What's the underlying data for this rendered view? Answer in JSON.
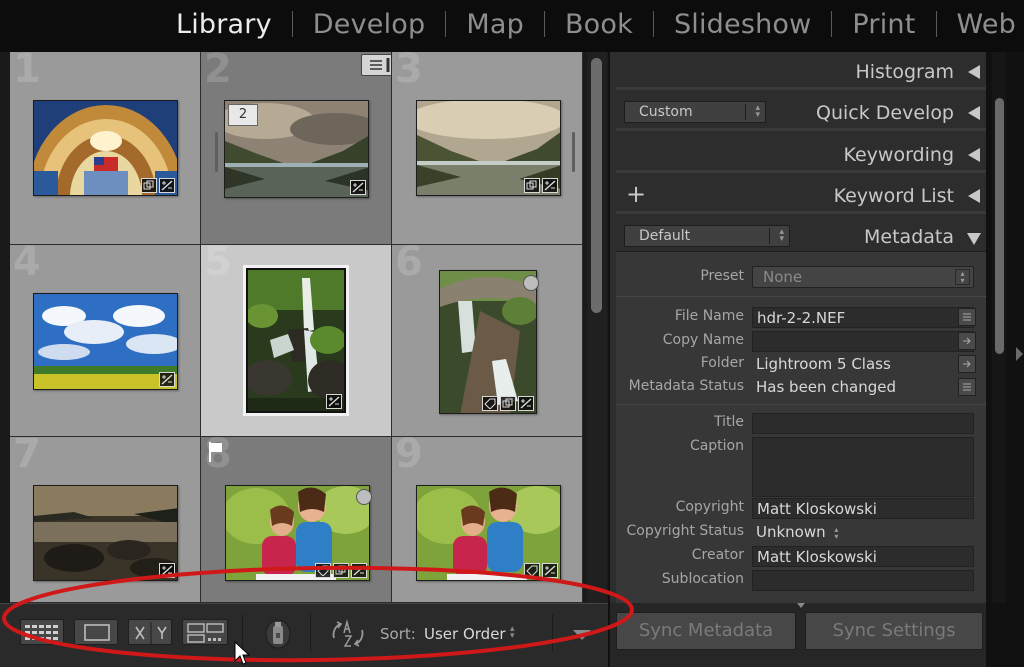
{
  "modules": [
    {
      "label": "Library",
      "active": true
    },
    {
      "label": "Develop",
      "active": false
    },
    {
      "label": "Map",
      "active": false
    },
    {
      "label": "Book",
      "active": false
    },
    {
      "label": "Slideshow",
      "active": false
    },
    {
      "label": "Print",
      "active": false
    },
    {
      "label": "Web",
      "active": false
    }
  ],
  "grid": {
    "cells": [
      {
        "num": "1",
        "photo": "rotunda-interior"
      },
      {
        "num": "2",
        "photo": "fjord-hdr",
        "stack_count": "2"
      },
      {
        "num": "3",
        "photo": "fjord"
      },
      {
        "num": "4",
        "photo": "blue-sky-field"
      },
      {
        "num": "5",
        "photo": "waterfall",
        "selected": true
      },
      {
        "num": "6",
        "photo": "stone-bridge-falls"
      },
      {
        "num": "7",
        "photo": "rocky-beach"
      },
      {
        "num": "8",
        "photo": "mother-daughter",
        "flagged": true
      },
      {
        "num": "9",
        "photo": "mother-daughter"
      }
    ]
  },
  "right_panel": {
    "histogram": {
      "title": "Histogram"
    },
    "quick_develop": {
      "title": "Quick Develop",
      "preset": "Custom"
    },
    "keywording": {
      "title": "Keywording"
    },
    "keyword_list": {
      "title": "Keyword List",
      "add_symbol": "+"
    },
    "metadata": {
      "title": "Metadata",
      "view_preset": "Default",
      "preset_label": "Preset",
      "preset_value": "None",
      "fields": {
        "file_name": {
          "label": "File Name",
          "value": "hdr-2-2.NEF"
        },
        "copy_name": {
          "label": "Copy Name",
          "value": ""
        },
        "folder": {
          "label": "Folder",
          "value": "Lightroom 5 Class"
        },
        "metadata_status": {
          "label": "Metadata Status",
          "value": "Has been changed"
        },
        "title": {
          "label": "Title",
          "value": ""
        },
        "caption": {
          "label": "Caption",
          "value": ""
        },
        "copyright": {
          "label": "Copyright",
          "value": "Matt Kloskowski"
        },
        "copyright_status": {
          "label": "Copyright Status",
          "value": "Unknown"
        },
        "creator": {
          "label": "Creator",
          "value": "Matt Kloskowski"
        },
        "sublocation": {
          "label": "Sublocation",
          "value": ""
        }
      }
    }
  },
  "toolbar": {
    "sort_label": "Sort:",
    "sort_value": "User Order"
  },
  "sync": {
    "metadata_label": "Sync Metadata",
    "settings_label": "Sync Settings"
  },
  "colors": {
    "annotation": "#d01818",
    "active_module": "#ececec",
    "inactive_module": "#8e8e8e"
  }
}
